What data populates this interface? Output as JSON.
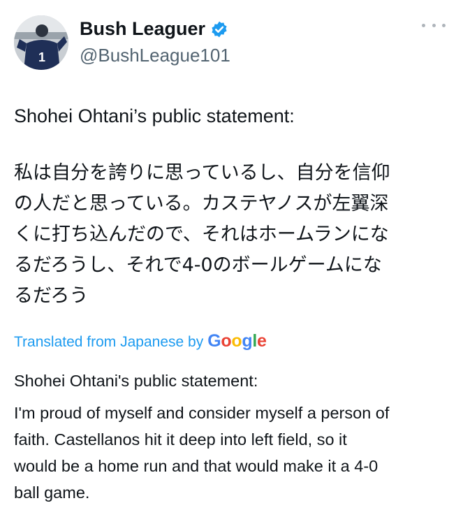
{
  "author": {
    "display_name": "Bush Leaguer",
    "handle": "@BushLeague101",
    "verified_icon": "verified-badge-icon",
    "avatar_jersey_number": "1"
  },
  "menu": {
    "icon": "more-options-icon"
  },
  "tweet": {
    "statement_line": "Shohei Ohtani’s public statement:",
    "japanese_lines": [
      "私は自分を誇りに思っているし、自分を信仰",
      "の人だと思っている。カステヤノスが左翼深",
      "くに打ち込んだので、それはホームランにな",
      "るだろうし、それで4-0のボールゲームにな",
      "るだろう"
    ]
  },
  "translation": {
    "label": "Translated from Japanese by",
    "provider": "Google",
    "title": "Shohei Ohtani's public statement:",
    "body_lines": [
      "I'm proud of myself and consider myself a person of",
      "faith. Castellanos hit it deep into left field, so it",
      "would be a home run and that would make it a 4-0",
      "ball game."
    ]
  },
  "colors": {
    "text": "#0f1419",
    "secondary": "#536471",
    "link": "#1d9bf0",
    "verified": "#1d9bf0"
  }
}
